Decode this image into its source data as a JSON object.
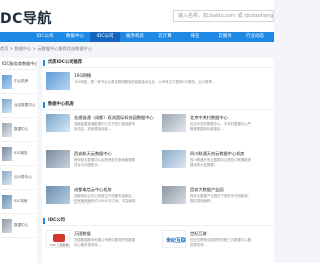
{
  "header": {
    "logo_text": "DC导航",
    "search_placeholder": "输入名称，如:baidu.com 或 idcdaohang.com"
  },
  "nav": {
    "items": [
      "",
      "IDC公司",
      "数据中心",
      "IDC公司",
      "服务机房",
      "云计算",
      "域名",
      "云服务",
      "行业动态"
    ],
    "active_index": 3
  },
  "breadcrumb": "首页 > 数据中心 > 云数据中心推荐优选数据中心",
  "sidebar": {
    "title": "IDC服务商数据中心",
    "items": [
      "中云机房",
      "北京数据中心",
      "数据中心",
      "IDC服务",
      "云计算中心",
      "IDC机房",
      "数据中心"
    ]
  },
  "sections": {
    "featured": {
      "title": "优质IDC公司推荐"
    },
    "datacenters": {
      "title": "数据中心机房"
    },
    "idc": {
      "title": "IDC公司"
    }
  },
  "featured_card": {
    "name": "191网络",
    "desc": "191网络，是一家专业从事互联网服务的高新技术企业，公司专注于提供IDC服务、云计算等..."
  },
  "dc_cards": [
    {
      "name": "金盾链通（成都）双流国际科技园数据中心",
      "desc": "成都金盾链通数据中心位于四川省成都市双流区，机房建设标准..."
    },
    {
      "name": "北京中关村数据中心",
      "desc": "北京中关村数据中心，中关村数据中心严格按照国际标准建设..."
    },
    {
      "name": "西安航天云数据中心",
      "desc": "西安航天数据中心由西安航天基地管理委员会与中国航天..."
    },
    {
      "name": "四川联通天府云数据中心机房",
      "desc": "四川联通天府云数据中心是四川联通投资建设的大型数据..."
    },
    {
      "name": "成都电信云中心机房",
      "desc": "成都电信云中心机房位于成都市高新区，机房使用面积约10000平方米，可容纳机柜4500个..."
    },
    {
      "name": "西安大数据产业园",
      "desc": "西安大数据产业园位于西安市沣西新城，园区规划面积..."
    }
  ],
  "idc_cards": [
    {
      "name": "万国数据",
      "desc": "万国数据服务有限公司是中国领先的数据中心服务提供商...",
      "logo_caption": "GDS 万国数据"
    },
    {
      "name": "世纪互联",
      "desc": "世纪互联是中国领先的第三方数据中心服务提供商...",
      "logo_caption": "世纪互联"
    }
  ]
}
